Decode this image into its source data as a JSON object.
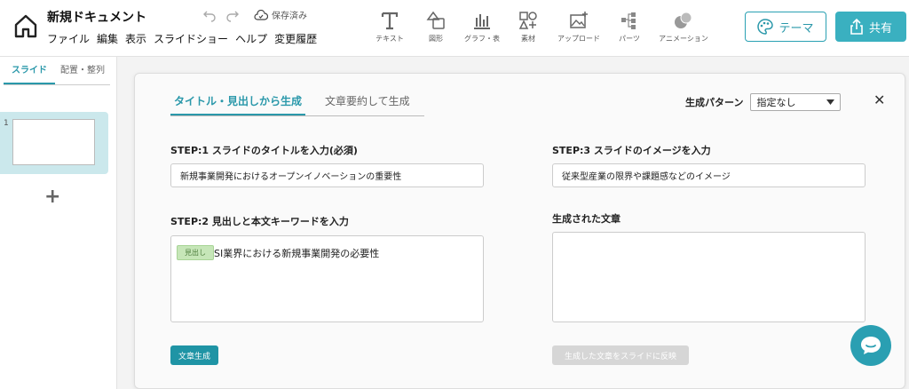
{
  "header": {
    "title": "新規ドキュメント",
    "save_status": "保存済み",
    "menu": [
      "ファイル",
      "編集",
      "表示",
      "スライドショー",
      "ヘルプ",
      "変更履歴"
    ],
    "tools": [
      "テキスト",
      "図形",
      "グラフ・表",
      "素材",
      "アップロード",
      "パーツ",
      "アニメーション"
    ],
    "theme_label": "テーマ",
    "share_label": "共有"
  },
  "leftpanel": {
    "tabs": [
      "スライド",
      "配置・整列"
    ],
    "slide_number": "1",
    "add_symbol": "+"
  },
  "dialog": {
    "tabs": [
      "タイトル・見出しから生成",
      "文章要約して生成"
    ],
    "pattern_label": "生成パターン",
    "pattern_value": "指定なし",
    "close_symbol": "✕",
    "step1_label": "STEP:1 スライドのタイトルを入力(必須)",
    "step1_value": "新規事業開発におけるオープンイノベーションの重要性",
    "step2_label": "STEP:2 見出しと本文キーワードを入力",
    "step2_tag": "見出し",
    "step2_keyword": "SI業界における新規事業開発の必要性",
    "step3_label": "STEP:3 スライドのイメージを入力",
    "step3_value": "従来型産業の限界や課題感などのイメージ",
    "result_label": "生成された文章",
    "generate_button": "文章生成",
    "apply_button": "生成した文章をスライドに反映"
  },
  "colors": {
    "accent": "#2a98aa",
    "accent_button": "#1f94a5",
    "slide_selected": "#cbe8ec",
    "tag_bg": "#c6e6b8"
  }
}
